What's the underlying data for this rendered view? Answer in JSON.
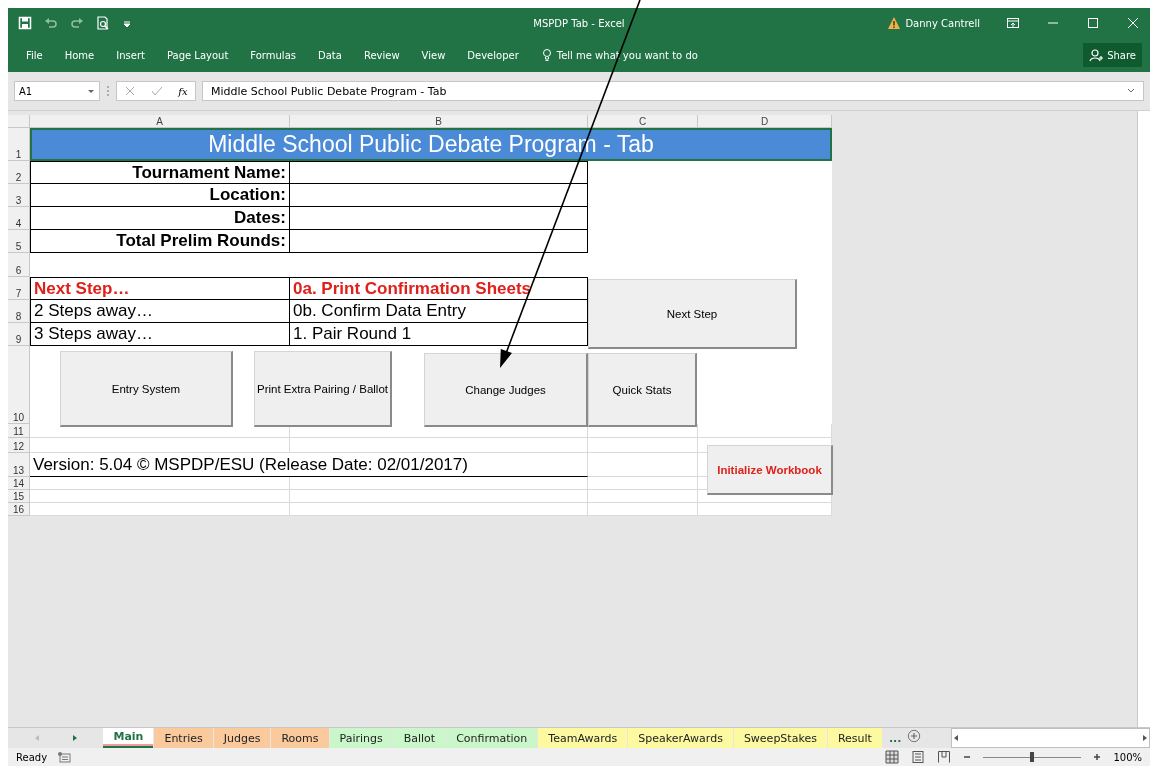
{
  "app": {
    "title": "MSPDP Tab - Excel",
    "user": "Danny Cantrell",
    "share": "Share",
    "tell_me": "Tell me what you want to do"
  },
  "menu": [
    "File",
    "Home",
    "Insert",
    "Page Layout",
    "Formulas",
    "Data",
    "Review",
    "View",
    "Developer"
  ],
  "formula_bar": {
    "name_box": "A1",
    "fx": "fx",
    "formula": "Middle School Public Debate Program  - Tab"
  },
  "columns": [
    "A",
    "B",
    "C",
    "D"
  ],
  "row_numbers": [
    "1",
    "2",
    "3",
    "4",
    "5",
    "6",
    "7",
    "8",
    "9",
    "10",
    "11",
    "12",
    "13",
    "14",
    "15",
    "16"
  ],
  "title": "Middle School Public Debate Program  - Tab",
  "info_fields": [
    {
      "label": "Tournament Name:"
    },
    {
      "label": "Location:"
    },
    {
      "label": "Dates:"
    },
    {
      "label": "Total Prelim Rounds:"
    }
  ],
  "steps": [
    {
      "label": "Next Step…",
      "value": "0a. Print Confirmation Sheets",
      "kind": "next"
    },
    {
      "label": "2 Steps away…",
      "value": "0b. Confirm Data Entry",
      "kind": "later"
    },
    {
      "label": "3 Steps away…",
      "value": "1. Pair Round 1",
      "kind": "later"
    }
  ],
  "version": "Version: 5.04 © MSPDP/ESU (Release Date: 02/01/2017)",
  "buttons": [
    {
      "label": "Next Step",
      "kind": "normal"
    },
    {
      "label": "Entry System",
      "kind": "normal"
    },
    {
      "label": "Print Extra Pairing / Ballot",
      "kind": "normal"
    },
    {
      "label": "Change Judges",
      "kind": "normal"
    },
    {
      "label": "Quick Stats",
      "kind": "normal"
    },
    {
      "label": "Initialize Workbook",
      "kind": "warning"
    }
  ],
  "sheet_tabs": [
    {
      "label": "Main",
      "color": "#f19c9c",
      "selected": true
    },
    {
      "label": "Entries",
      "color": "#fac99c",
      "selected": false
    },
    {
      "label": "Judges",
      "color": "#fac99c",
      "selected": false
    },
    {
      "label": "Rooms",
      "color": "#fac99c",
      "selected": false
    },
    {
      "label": "Pairings",
      "color": "#c9f7c9",
      "selected": false
    },
    {
      "label": "Ballot",
      "color": "#c9f7c9",
      "selected": false
    },
    {
      "label": "Confirmation",
      "color": "#c9f7c9",
      "selected": false
    },
    {
      "label": "TeamAwards",
      "color": "#fdf9a0",
      "selected": false
    },
    {
      "label": "SpeakerAwards",
      "color": "#fdf9a0",
      "selected": false
    },
    {
      "label": "SweepStakes",
      "color": "#fdf9a0",
      "selected": false
    },
    {
      "label": "Result",
      "color": "#fdf9a0",
      "selected": false
    }
  ],
  "more_tabs": "...",
  "status": {
    "text": "Ready",
    "zoom": "100%",
    "zoom_slider": {
      "level": 0.5
    }
  }
}
